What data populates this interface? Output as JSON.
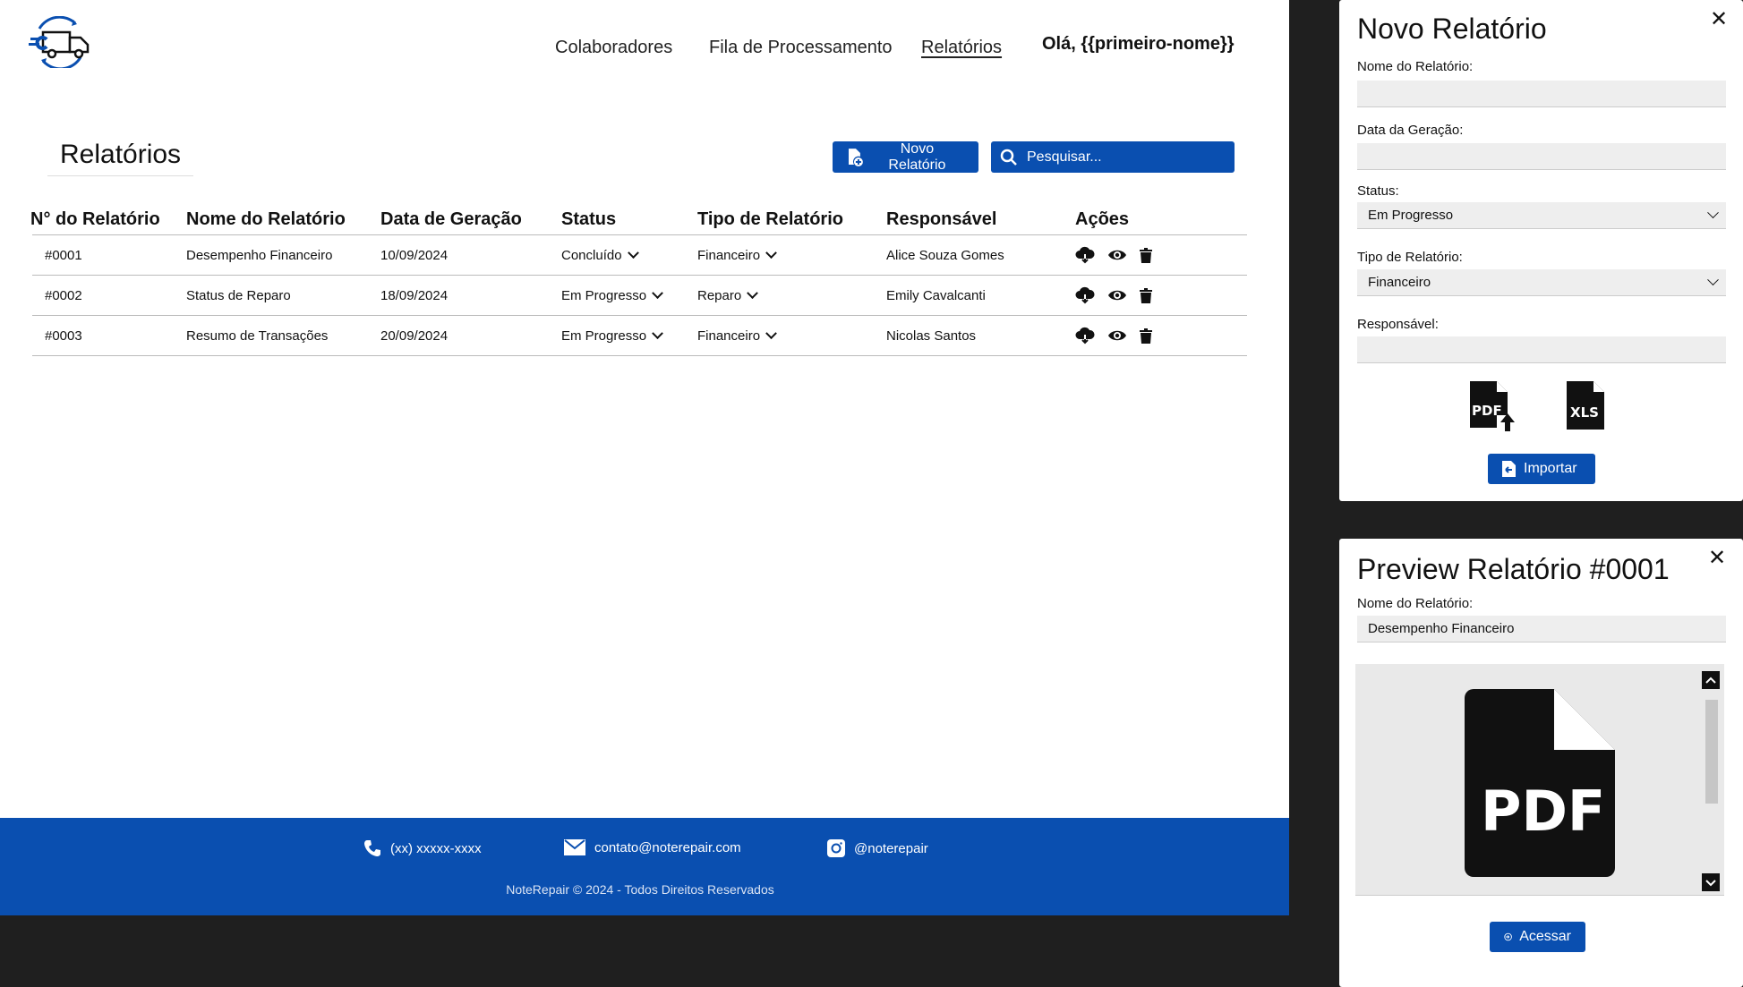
{
  "nav": {
    "items": [
      "Colaboradores",
      "Fila de Processamento",
      "Relatórios"
    ],
    "active": "Relatórios",
    "greeting": "Olá, {{primeiro-nome}}"
  },
  "page": {
    "title": "Relatórios",
    "new_button": "Novo Relatório",
    "search_placeholder": "Pesquisar..."
  },
  "table": {
    "headers": [
      "N° do Relatório",
      "Nome do Relatório",
      "Data de Geração",
      "Status",
      "Tipo de Relatório",
      "Responsável",
      "Ações"
    ],
    "rows": [
      {
        "id": "#0001",
        "name": "Desempenho Financeiro",
        "date": "10/09/2024",
        "status": "Concluído",
        "type": "Financeiro",
        "owner": "Alice Souza Gomes"
      },
      {
        "id": "#0002",
        "name": "Status de Reparo",
        "date": "18/09/2024",
        "status": "Em Progresso",
        "type": "Reparo",
        "owner": "Emily Cavalcanti"
      },
      {
        "id": "#0003",
        "name": "Resumo de Transações",
        "date": "20/09/2024",
        "status": "Em Progresso",
        "type": "Financeiro",
        "owner": "Nicolas Santos"
      }
    ]
  },
  "footer": {
    "phone": "(xx) xxxxx-xxxx",
    "email": "contato@noterepair.com",
    "instagram": "@noterepair",
    "copyright": "NoteRepair © 2024 - Todos Direitos Reservados"
  },
  "new_report_panel": {
    "title": "Novo Relatório",
    "name_label": "Nome do Relatório:",
    "name_value": "",
    "date_label": "Data da Geração:",
    "date_value": "",
    "status_label": "Status:",
    "status_value": "Em Progresso",
    "type_label": "Tipo de Relatório:",
    "type_value": "Financeiro",
    "owner_label": "Responsável:",
    "owner_value": "",
    "import_button": "Importar"
  },
  "preview_panel": {
    "title": "Preview Relatório #0001",
    "name_label": "Nome do Relatório:",
    "name_value": "Desempenho Financeiro",
    "access_button": "Acessar"
  },
  "colors": {
    "brand_blue": "#0a4fb0",
    "backdrop": "#1f1f1f"
  },
  "icons": [
    "logo-truck-icon",
    "document-plus-icon",
    "search-icon",
    "cloud-download-icon",
    "eye-icon",
    "trash-icon",
    "phone-icon",
    "mail-icon",
    "instagram-icon",
    "close-icon",
    "pdf-upload-icon",
    "xls-file-icon",
    "import-icon",
    "login-icon",
    "pdf-file-icon",
    "chevron-up-icon",
    "chevron-down-icon"
  ]
}
